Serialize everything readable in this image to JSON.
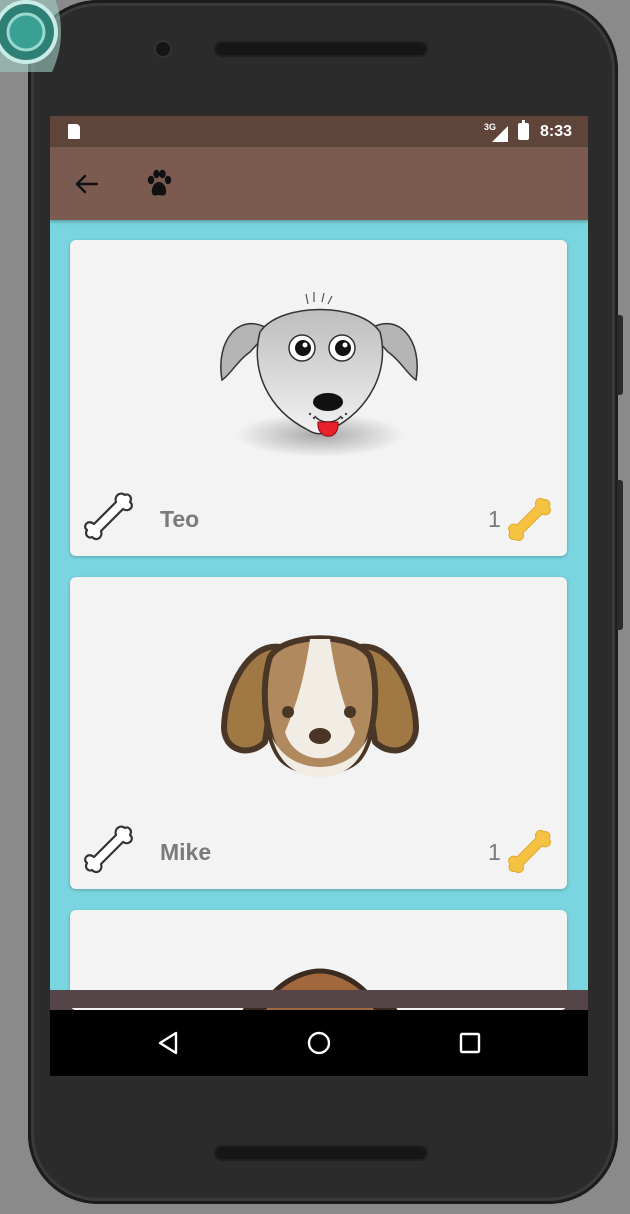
{
  "status_bar": {
    "network": "3G",
    "time": "8:33"
  },
  "toolbar": {
    "back_icon": "arrow-back-icon",
    "logo_icon": "paw-icon"
  },
  "dogs": [
    {
      "name": "Teo",
      "count": "1",
      "avatar": "grey-dog-icon"
    },
    {
      "name": "Mike",
      "count": "1",
      "avatar": "beagle-dog-icon"
    },
    {
      "name": "",
      "count": "",
      "avatar": "brown-dog-icon"
    }
  ],
  "colors": {
    "status_bar": "#5e4439",
    "toolbar": "#7b5a4f",
    "background": "#79d5df",
    "card": "#f3f3f3",
    "bone_gold": "#f5c242"
  },
  "nav": {
    "back_icon": "triangle-back-icon",
    "home_icon": "circle-home-icon",
    "recents_icon": "square-recents-icon"
  }
}
